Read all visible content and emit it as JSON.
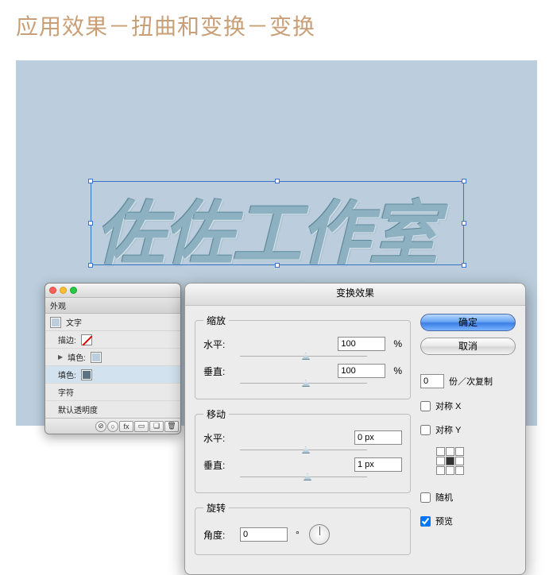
{
  "heading": "应用效果－扭曲和变换－变换",
  "artwork_text": "佐佐工作室",
  "appearance": {
    "tab": "外观",
    "object_label": "文字",
    "rows": {
      "stroke": "描边:",
      "fill1": "填色:",
      "fill2": "填色:",
      "chars": "字符",
      "opacity": "默认透明度"
    }
  },
  "dialog": {
    "title": "变换效果",
    "scale": {
      "legend": "缩放",
      "h_label": "水平:",
      "h_value": "100",
      "v_label": "垂直:",
      "v_value": "100",
      "unit": "%"
    },
    "move": {
      "legend": "移动",
      "h_label": "水平:",
      "h_value": "0 px",
      "v_label": "垂直:",
      "v_value": "1 px"
    },
    "rotate": {
      "legend": "旋转",
      "angle_label": "角度:",
      "angle_value": "0",
      "degree": "°"
    },
    "buttons": {
      "ok": "确定",
      "cancel": "取消"
    },
    "copies": {
      "value": "0",
      "label": "份／次复制"
    },
    "options": {
      "reflect_x": "对称 X",
      "reflect_y": "对称 Y",
      "random": "随机",
      "preview": "预览"
    }
  }
}
